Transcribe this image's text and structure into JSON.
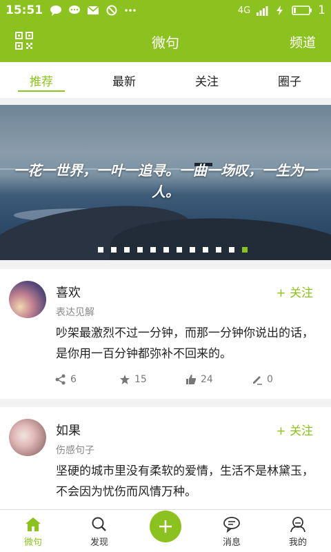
{
  "status": {
    "time": "15:51",
    "network": "4G",
    "battery": "1",
    "icons": [
      "chat-bubble-icon",
      "message-dots-icon",
      "mail-icon",
      "blocked-icon",
      "more-dots-icon"
    ]
  },
  "header": {
    "title": "微句",
    "channel": "频道",
    "left_icon": "qr-code-icon"
  },
  "tabs": [
    {
      "label": "推荐",
      "active": true
    },
    {
      "label": "最新",
      "active": false
    },
    {
      "label": "关注",
      "active": false
    },
    {
      "label": "圈子",
      "active": false
    }
  ],
  "banner": {
    "quote": "一花一世界，一叶一追寻。一曲一场叹，一生为一人。",
    "slide_count": 12,
    "active_slide": 12
  },
  "posts": [
    {
      "name": "喜欢",
      "category": "表达见解",
      "follow": "+ 关注",
      "text": "吵架最激烈不过一分钟，而那一分钟你说出的话，是你用一百分钟都弥补不回来的。",
      "shares": "6",
      "favorites": "15",
      "likes": "24",
      "comments": "0"
    },
    {
      "name": "如果",
      "category": "伤感句子",
      "follow": "+ 关注",
      "text": "坚硬的城市里没有柔软的爱情，生活不是林黛玉，不会因为忧伤而风情万种。"
    }
  ],
  "bottom_nav": [
    {
      "label": "微句",
      "icon": "home-icon",
      "active": true
    },
    {
      "label": "发现",
      "icon": "search-icon",
      "active": false
    },
    {
      "label": "",
      "icon": "plus-icon",
      "active": false
    },
    {
      "label": "消息",
      "icon": "message-icon",
      "active": false
    },
    {
      "label": "我的",
      "icon": "profile-icon",
      "active": false
    }
  ],
  "colors": {
    "accent": "#8cc21f",
    "text": "#222222",
    "muted": "#888888"
  }
}
